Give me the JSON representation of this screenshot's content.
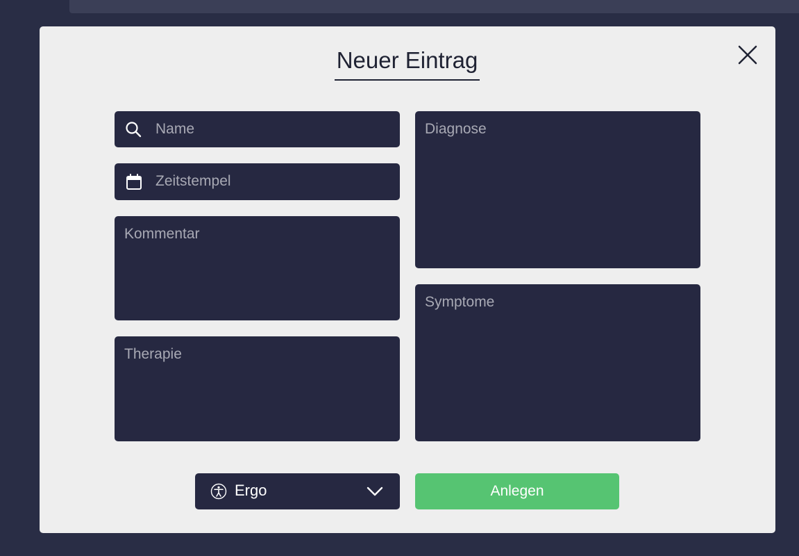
{
  "background": {
    "color": "#292d45"
  },
  "modal": {
    "title": "Neuer Eintrag",
    "close_icon": "close-icon",
    "fields": {
      "name": {
        "placeholder": "Name",
        "icon": "search-icon"
      },
      "zeitstempel": {
        "placeholder": "Zeitstempel",
        "icon": "calendar-icon"
      },
      "kommentar": {
        "placeholder": "Kommentar"
      },
      "therapie": {
        "placeholder": "Therapie"
      },
      "diagnose": {
        "placeholder": "Diagnose"
      },
      "symptome": {
        "placeholder": "Symptome"
      }
    },
    "category_select": {
      "value": "Ergo",
      "icon": "accessibility-icon",
      "chevron": "chevron-down-icon"
    },
    "submit_label": "Anlegen",
    "colors": {
      "field": "#262841",
      "accent": "#56c472",
      "modal": "#eeeeee"
    }
  }
}
